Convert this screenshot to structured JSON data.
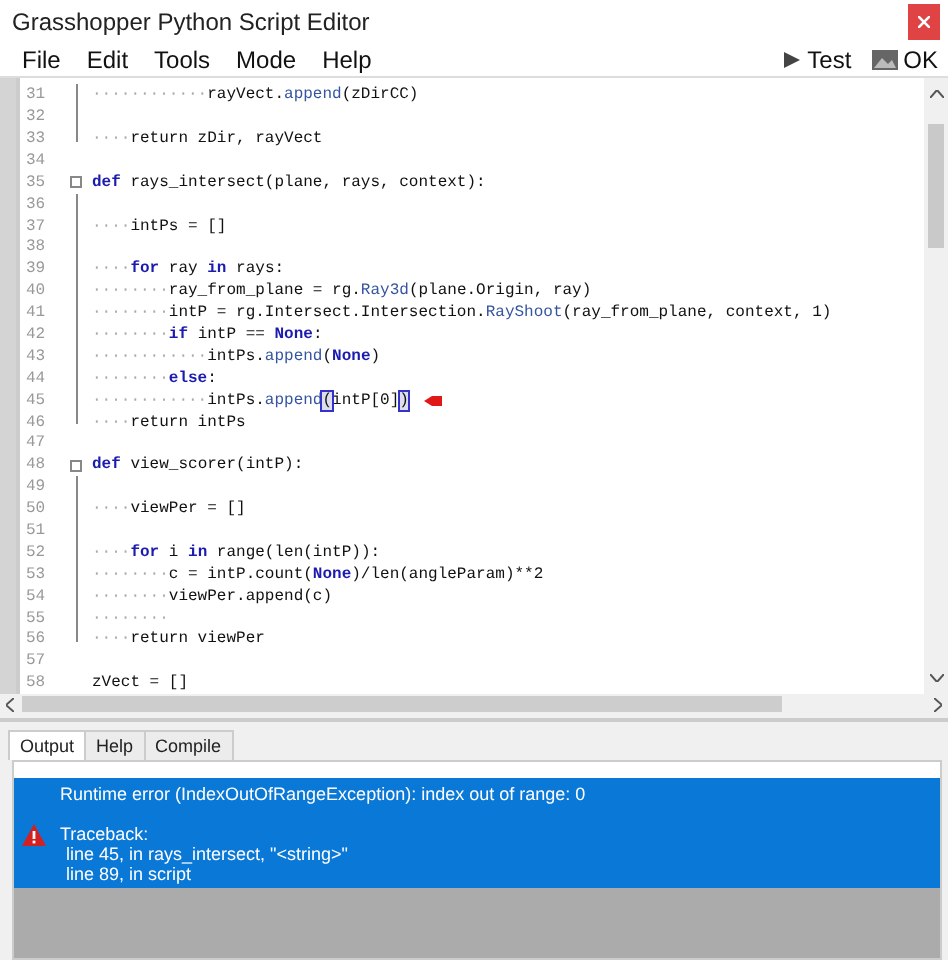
{
  "window": {
    "title": "Grasshopper Python Script Editor"
  },
  "menu": [
    "File",
    "Edit",
    "Tools",
    "Mode",
    "Help"
  ],
  "toolbar": [
    {
      "label": "Test",
      "kind": "play"
    },
    {
      "label": "OK",
      "kind": "ok"
    }
  ],
  "editor": {
    "lines": [
      {
        "number": "31",
        "fold_guide": true,
        "parts": [
          {
            "text": "············",
            "kind": "ws"
          },
          {
            "text": "rayVect.",
            "kind": "plain"
          },
          {
            "text": "append",
            "kind": "fn"
          },
          {
            "text": "(zDirCC)",
            "kind": "plain"
          }
        ]
      },
      {
        "number": "32",
        "fold_guide": true
      },
      {
        "number": "33",
        "fold_end": true,
        "parts": [
          {
            "text": "····",
            "kind": "ws"
          },
          {
            "text": "return zDir, rayVect",
            "kind": "plain"
          }
        ]
      },
      {
        "number": "34"
      },
      {
        "number": "35",
        "fold_toggle": true,
        "parts": [
          {
            "text": "def",
            "kind": "kw"
          },
          {
            "text": " rays_intersect(plane, rays, context):",
            "kind": "plain"
          }
        ]
      },
      {
        "number": "36",
        "fold_guide": true
      },
      {
        "number": "37",
        "fold_guide": true,
        "parts": [
          {
            "text": "····",
            "kind": "ws"
          },
          {
            "text": "intPs = []",
            "kind": "plain"
          }
        ]
      },
      {
        "number": "38",
        "fold_guide": true
      },
      {
        "number": "39",
        "fold_guide": true,
        "parts": [
          {
            "text": "····",
            "kind": "ws"
          },
          {
            "text": "for",
            "kind": "kw"
          },
          {
            "text": " ray ",
            "kind": "plain"
          },
          {
            "text": "in",
            "kind": "kw"
          },
          {
            "text": " rays:",
            "kind": "plain"
          }
        ]
      },
      {
        "number": "40",
        "fold_guide": true,
        "parts": [
          {
            "text": "········",
            "kind": "ws"
          },
          {
            "text": "ray_from_plane = rg.",
            "kind": "plain"
          },
          {
            "text": "Ray3d",
            "kind": "fn"
          },
          {
            "text": "(plane.Origin, ray)",
            "kind": "plain"
          }
        ]
      },
      {
        "number": "41",
        "fold_guide": true,
        "parts": [
          {
            "text": "········",
            "kind": "ws"
          },
          {
            "text": "intP = rg.Intersect.Intersection.",
            "kind": "plain"
          },
          {
            "text": "RayShoot",
            "kind": "fn"
          },
          {
            "text": "(ray_from_plane, context, 1)",
            "kind": "plain"
          }
        ]
      },
      {
        "number": "42",
        "fold_guide": true,
        "parts": [
          {
            "text": "········",
            "kind": "ws"
          },
          {
            "text": "if",
            "kind": "kw"
          },
          {
            "text": " intP == ",
            "kind": "plain"
          },
          {
            "text": "None",
            "kind": "kw"
          },
          {
            "text": ":",
            "kind": "plain"
          }
        ]
      },
      {
        "number": "43",
        "fold_guide": true,
        "parts": [
          {
            "text": "············",
            "kind": "ws"
          },
          {
            "text": "intPs.",
            "kind": "plain"
          },
          {
            "text": "append",
            "kind": "fn"
          },
          {
            "text": "(",
            "kind": "plain"
          },
          {
            "text": "None",
            "kind": "kw"
          },
          {
            "text": ")",
            "kind": "plain"
          }
        ]
      },
      {
        "number": "44",
        "fold_guide": true,
        "parts": [
          {
            "text": "········",
            "kind": "ws"
          },
          {
            "text": "else",
            "kind": "kw"
          },
          {
            "text": ":",
            "kind": "plain"
          }
        ]
      },
      {
        "number": "45",
        "fold_guide": true,
        "marker": true,
        "parts": [
          {
            "text": "············",
            "kind": "ws"
          },
          {
            "text": "intPs.",
            "kind": "plain"
          },
          {
            "text": "append",
            "kind": "fn"
          },
          {
            "text": "(",
            "kind": "bracket"
          },
          {
            "text": "intP[0]",
            "kind": "plain"
          },
          {
            "text": ")",
            "kind": "bracket"
          }
        ]
      },
      {
        "number": "46",
        "fold_end": true,
        "parts": [
          {
            "text": "····",
            "kind": "ws"
          },
          {
            "text": "return intPs",
            "kind": "plain"
          }
        ]
      },
      {
        "number": "47"
      },
      {
        "number": "48",
        "fold_toggle": true,
        "parts": [
          {
            "text": "def",
            "kind": "kw"
          },
          {
            "text": " view_scorer(intP):",
            "kind": "plain"
          }
        ]
      },
      {
        "number": "49",
        "fold_guide": true
      },
      {
        "number": "50",
        "fold_guide": true,
        "parts": [
          {
            "text": "····",
            "kind": "ws"
          },
          {
            "text": "viewPer = []",
            "kind": "plain"
          }
        ]
      },
      {
        "number": "51",
        "fold_guide": true
      },
      {
        "number": "52",
        "fold_guide": true,
        "parts": [
          {
            "text": "····",
            "kind": "ws"
          },
          {
            "text": "for",
            "kind": "kw"
          },
          {
            "text": " i ",
            "kind": "plain"
          },
          {
            "text": "in",
            "kind": "kw"
          },
          {
            "text": " range(len(intP)):",
            "kind": "plain"
          }
        ]
      },
      {
        "number": "53",
        "fold_guide": true,
        "parts": [
          {
            "text": "········",
            "kind": "ws"
          },
          {
            "text": "c = intP.count(",
            "kind": "plain"
          },
          {
            "text": "None",
            "kind": "kw"
          },
          {
            "text": ")/len(angleParam)**2",
            "kind": "plain"
          }
        ]
      },
      {
        "number": "54",
        "fold_guide": true,
        "parts": [
          {
            "text": "········",
            "kind": "ws"
          },
          {
            "text": "viewPer.append(c)",
            "kind": "plain"
          }
        ]
      },
      {
        "number": "55",
        "fold_guide": true,
        "parts": [
          {
            "text": "········",
            "kind": "ws"
          }
        ]
      },
      {
        "number": "56",
        "fold_end": true,
        "parts": [
          {
            "text": "····",
            "kind": "ws"
          },
          {
            "text": "return viewPer",
            "kind": "plain"
          }
        ]
      },
      {
        "number": "57"
      },
      {
        "number": "58",
        "parts": [
          {
            "text": "zVect = []",
            "kind": "plain"
          }
        ]
      }
    ]
  },
  "output_tabs": [
    {
      "label": "Output",
      "selected": true
    },
    {
      "label": "Help",
      "selected": false
    },
    {
      "label": "Compile",
      "selected": false
    }
  ],
  "output": {
    "entries": [
      {
        "kind": "error",
        "selected": true,
        "message": "Runtime error (IndexOutOfRangeException): index out of range: 0",
        "traceback": [
          "Traceback:",
          "line 45, in rays_intersect, \"<string>\"",
          "line 89, in script"
        ]
      }
    ]
  }
}
